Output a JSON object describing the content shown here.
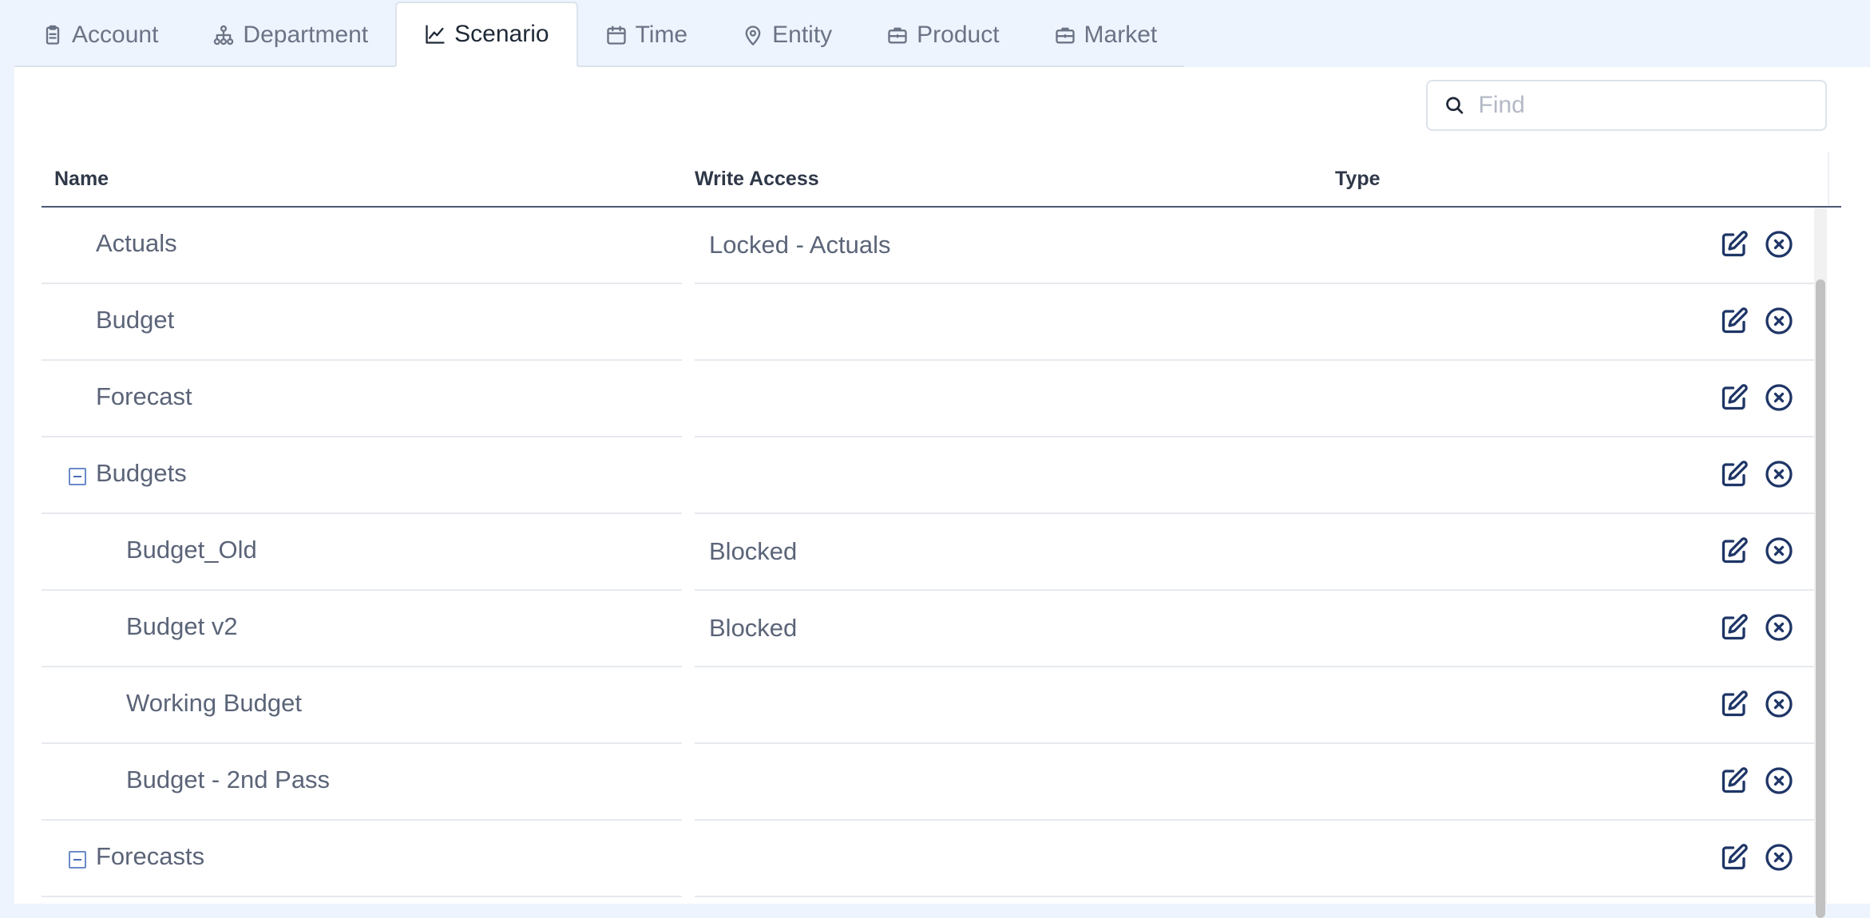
{
  "tabs": [
    {
      "label": "Account",
      "icon": "clipboard-icon",
      "active": false
    },
    {
      "label": "Department",
      "icon": "org-chart-icon",
      "active": false
    },
    {
      "label": "Scenario",
      "icon": "line-chart-icon",
      "active": true
    },
    {
      "label": "Time",
      "icon": "calendar-icon",
      "active": false
    },
    {
      "label": "Entity",
      "icon": "map-pin-icon",
      "active": false
    },
    {
      "label": "Product",
      "icon": "briefcase-icon",
      "active": false
    },
    {
      "label": "Market",
      "icon": "briefcase-icon",
      "active": false
    }
  ],
  "search": {
    "placeholder": "Find",
    "value": ""
  },
  "table": {
    "columns": {
      "name": "Name",
      "write_access": "Write Access",
      "type": "Type"
    },
    "rows": [
      {
        "name": "Actuals",
        "write_access": "Locked - Actuals",
        "type": "",
        "level": 1,
        "group": false
      },
      {
        "name": "Budget",
        "write_access": "",
        "type": "",
        "level": 1,
        "group": false
      },
      {
        "name": "Forecast",
        "write_access": "",
        "type": "",
        "level": 1,
        "group": false
      },
      {
        "name": "Budgets",
        "write_access": "",
        "type": "",
        "level": 1,
        "group": true,
        "expanded": true
      },
      {
        "name": "Budget_Old",
        "write_access": "Blocked",
        "type": "",
        "level": 2,
        "group": false
      },
      {
        "name": "Budget v2",
        "write_access": "Blocked",
        "type": "",
        "level": 2,
        "group": false
      },
      {
        "name": "Working Budget",
        "write_access": "",
        "type": "",
        "level": 2,
        "group": false
      },
      {
        "name": "Budget - 2nd Pass",
        "write_access": "",
        "type": "",
        "level": 2,
        "group": false
      },
      {
        "name": "Forecasts",
        "write_access": "",
        "type": "",
        "level": 1,
        "group": true,
        "expanded": true
      }
    ]
  },
  "colors": {
    "accent": "#1e3566",
    "background": "#eef4fd",
    "text": "#5b6478"
  }
}
